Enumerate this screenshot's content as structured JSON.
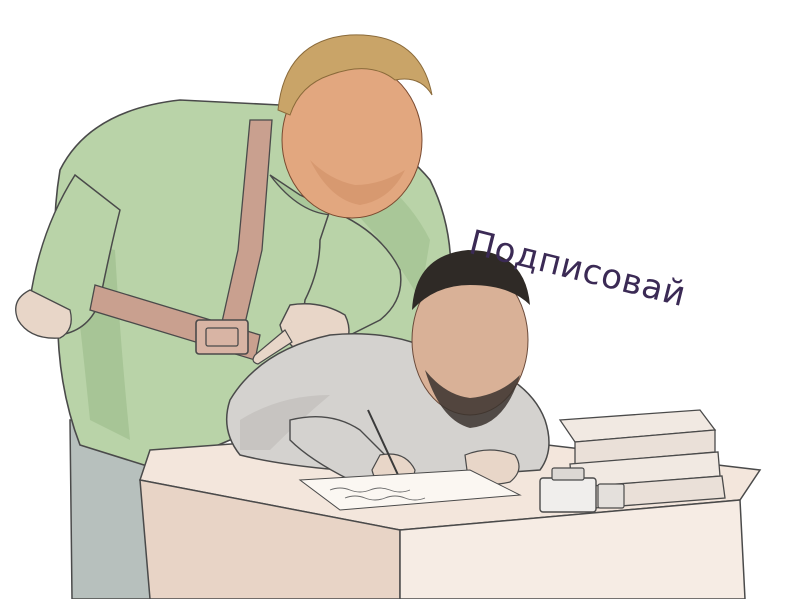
{
  "caption": {
    "text": "Подписовай",
    "color": "#3b2a55"
  },
  "palette": {
    "tunic_green": "#b9d3a8",
    "tunic_shadow": "#9fbf8e",
    "belt": "#c9a08f",
    "sweater_grey": "#d4d2cf",
    "desk": "#f3e6dc",
    "desk_edge": "#e8d4c6",
    "trousers": "#b7c0bd",
    "ink_line": "#4a4a4a",
    "hair_blond": "#c9a468",
    "hair_dark": "#2f2a26",
    "skin_warm": "#e2a77f",
    "skin_pale": "#d9b197"
  }
}
